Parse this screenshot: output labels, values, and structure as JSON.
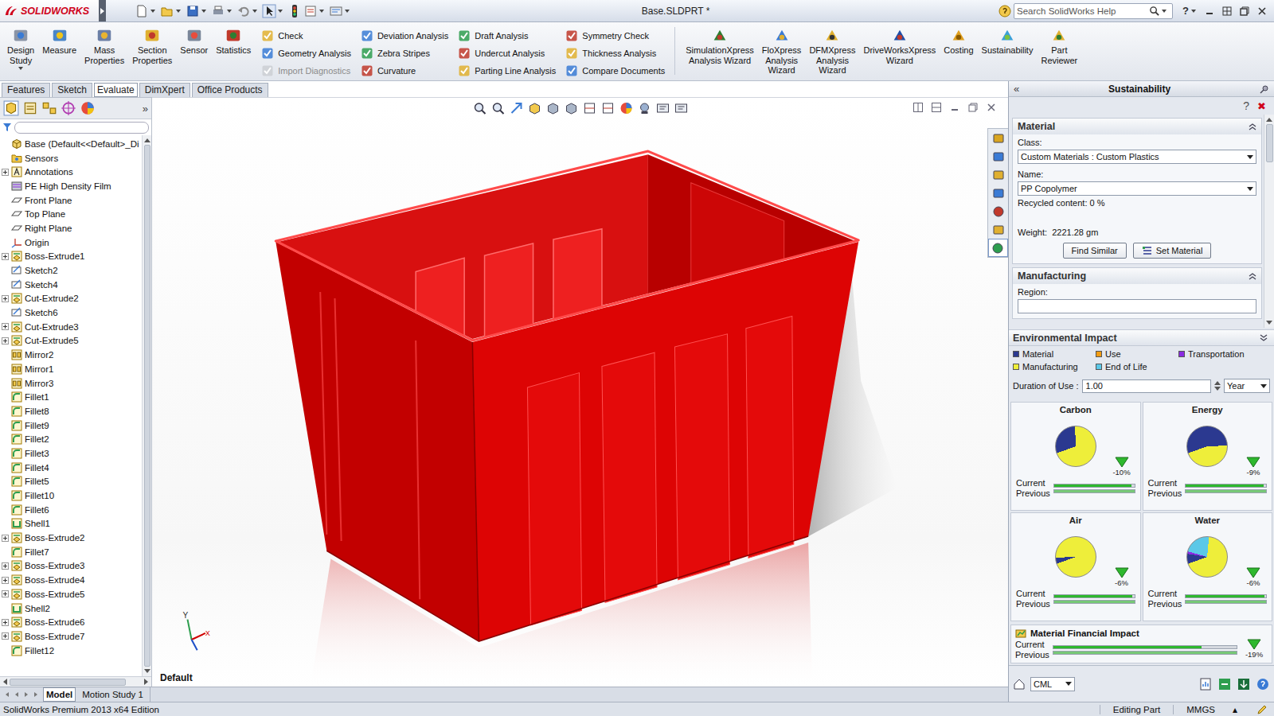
{
  "window": {
    "logo_text": "SOLIDWORKS",
    "title": "Base.SLDPRT *",
    "search_placeholder": "Search SolidWorks Help",
    "help": "?"
  },
  "ribbon": {
    "large_left": [
      {
        "label": "Design\nStudy",
        "dropdown": true
      },
      {
        "label": "Measure",
        "dropdown": false
      },
      {
        "label": "Mass\nProperties",
        "dropdown": false
      },
      {
        "label": "Section\nProperties",
        "dropdown": false
      },
      {
        "label": "Sensor",
        "dropdown": false
      },
      {
        "label": "Statistics",
        "dropdown": false
      }
    ],
    "small_columns": [
      [
        {
          "label": "Check",
          "disabled": false
        },
        {
          "label": "Geometry Analysis",
          "disabled": false
        },
        {
          "label": "Import Diagnostics",
          "disabled": true
        }
      ],
      [
        {
          "label": "Deviation Analysis",
          "disabled": false
        },
        {
          "label": "Zebra Stripes",
          "disabled": false
        },
        {
          "label": "Curvature",
          "disabled": false
        }
      ],
      [
        {
          "label": "Draft Analysis",
          "disabled": false
        },
        {
          "label": "Undercut Analysis",
          "disabled": false
        },
        {
          "label": "Parting Line Analysis",
          "disabled": false
        }
      ],
      [
        {
          "label": "Symmetry Check",
          "disabled": false
        },
        {
          "label": "Thickness Analysis",
          "disabled": false
        },
        {
          "label": "Compare Documents",
          "disabled": false
        }
      ]
    ],
    "large_right": [
      {
        "label": "SimulationXpress\nAnalysis Wizard"
      },
      {
        "label": "FloXpress\nAnalysis\nWizard"
      },
      {
        "label": "DFMXpress\nAnalysis\nWizard"
      },
      {
        "label": "DriveWorksXpress\nWizard"
      },
      {
        "label": "Costing"
      },
      {
        "label": "Sustainability"
      },
      {
        "label": "Part\nReviewer"
      }
    ]
  },
  "tabs": [
    {
      "label": "Features",
      "selected": false
    },
    {
      "label": "Sketch",
      "selected": false
    },
    {
      "label": "Evaluate",
      "selected": true
    },
    {
      "label": "DimXpert",
      "selected": false
    },
    {
      "label": "Office Products",
      "selected": false
    }
  ],
  "tree": {
    "more": "»",
    "items": [
      {
        "label": "Base (Default<<Default>_Di",
        "kind": "part",
        "expandable": false
      },
      {
        "label": "Sensors",
        "kind": "folder",
        "expandable": false
      },
      {
        "label": "Annotations",
        "kind": "annotations",
        "expandable": true
      },
      {
        "label": "PE High Density Film",
        "kind": "material",
        "expandable": false
      },
      {
        "label": "Front Plane",
        "kind": "plane",
        "expandable": false
      },
      {
        "label": "Top Plane",
        "kind": "plane",
        "expandable": false
      },
      {
        "label": "Right Plane",
        "kind": "plane",
        "expandable": false
      },
      {
        "label": "Origin",
        "kind": "origin",
        "expandable": false
      },
      {
        "label": "Boss-Extrude1",
        "kind": "extrude",
        "expandable": true
      },
      {
        "label": "Sketch2",
        "kind": "sketch",
        "expandable": false
      },
      {
        "label": "Sketch4",
        "kind": "sketch",
        "expandable": false
      },
      {
        "label": "Cut-Extrude2",
        "kind": "extrude",
        "expandable": true
      },
      {
        "label": "Sketch6",
        "kind": "sketch",
        "expandable": false
      },
      {
        "label": "Cut-Extrude3",
        "kind": "extrude",
        "expandable": true
      },
      {
        "label": "Cut-Extrude5",
        "kind": "extrude",
        "expandable": true
      },
      {
        "label": "Mirror2",
        "kind": "mirror",
        "expandable": false
      },
      {
        "label": "Mirror1",
        "kind": "mirror",
        "expandable": false
      },
      {
        "label": "Mirror3",
        "kind": "mirror",
        "expandable": false
      },
      {
        "label": "Fillet1",
        "kind": "fillet",
        "expandable": false
      },
      {
        "label": "Fillet8",
        "kind": "fillet",
        "expandable": false
      },
      {
        "label": "Fillet9",
        "kind": "fillet",
        "expandable": false
      },
      {
        "label": "Fillet2",
        "kind": "fillet",
        "expandable": false
      },
      {
        "label": "Fillet3",
        "kind": "fillet",
        "expandable": false
      },
      {
        "label": "Fillet4",
        "kind": "fillet",
        "expandable": false
      },
      {
        "label": "Fillet5",
        "kind": "fillet",
        "expandable": false
      },
      {
        "label": "Fillet10",
        "kind": "fillet",
        "expandable": false
      },
      {
        "label": "Fillet6",
        "kind": "fillet",
        "expandable": false
      },
      {
        "label": "Shell1",
        "kind": "shell",
        "expandable": false
      },
      {
        "label": "Boss-Extrude2",
        "kind": "extrude",
        "expandable": true
      },
      {
        "label": "Fillet7",
        "kind": "fillet",
        "expandable": false
      },
      {
        "label": "Boss-Extrude3",
        "kind": "extrude",
        "expandable": true
      },
      {
        "label": "Boss-Extrude4",
        "kind": "extrude",
        "expandable": true
      },
      {
        "label": "Boss-Extrude5",
        "kind": "extrude",
        "expandable": true
      },
      {
        "label": "Shell2",
        "kind": "shell",
        "expandable": false
      },
      {
        "label": "Boss-Extrude6",
        "kind": "extrude",
        "expandable": true
      },
      {
        "label": "Boss-Extrude7",
        "kind": "extrude",
        "expandable": true
      },
      {
        "label": "Fillet12",
        "kind": "fillet",
        "expandable": false
      }
    ]
  },
  "viewport": {
    "configuration": "Default",
    "triad": {
      "y": "Y",
      "x": "X"
    }
  },
  "task_pane": [
    {
      "selected": false
    },
    {
      "selected": false
    },
    {
      "selected": false
    },
    {
      "selected": false
    },
    {
      "selected": false
    },
    {
      "selected": false
    },
    {
      "selected": true
    }
  ],
  "panel": {
    "collapse": "«",
    "title": "Sustainability",
    "help": "?",
    "close": "✖",
    "material": {
      "title": "Material",
      "class_label": "Class:",
      "class_value": "Custom Materials : Custom Plastics",
      "name_label": "Name:",
      "name_value": "PP Copolymer",
      "recycled": "Recycled content: 0 %",
      "weight": "Weight:  2221.28 gm",
      "buttons": [
        "Find Similar",
        "Set Material"
      ]
    },
    "manufacturing": {
      "title": "Manufacturing",
      "region_label": "Region:"
    },
    "impact": {
      "title": "Environmental Impact",
      "legend": [
        {
          "label": "Material",
          "color": "#2b3990"
        },
        {
          "label": "Use",
          "color": "#f39c12"
        },
        {
          "label": "Transportation",
          "color": "#8b2be2"
        },
        {
          "label": "Manufacturing",
          "color": "#eeee3a"
        },
        {
          "label": "End of Life",
          "color": "#5bc8e8"
        }
      ],
      "duration_label": "Duration of Use :",
      "duration_value": "1.00",
      "duration_unit": "Year",
      "current_label": "Current",
      "previous_label": "Previous",
      "cards": [
        {
          "title": "Carbon",
          "change": "-10%",
          "trend": "down",
          "current": 0.97,
          "previous": 1.0,
          "slices": [
            {
              "share": 0.3,
              "color": "#2b3990"
            },
            {
              "share": 0.7,
              "color": "#eeee3a"
            }
          ]
        },
        {
          "title": "Energy",
          "change": "-9%",
          "trend": "down",
          "current": 0.97,
          "previous": 1.0,
          "slices": [
            {
              "share": 0.55,
              "color": "#2b3990"
            },
            {
              "share": 0.45,
              "color": "#eeee3a"
            }
          ]
        },
        {
          "title": "Air",
          "change": "-6%",
          "trend": "down",
          "current": 0.98,
          "previous": 1.0,
          "slices": [
            {
              "share": 0.05,
              "color": "#2b3990"
            },
            {
              "share": 0.95,
              "color": "#eeee3a"
            }
          ]
        },
        {
          "title": "Water",
          "change": "-6%",
          "trend": "down",
          "current": 0.98,
          "previous": 1.0,
          "slices": [
            {
              "share": 0.08,
              "color": "#2b3990"
            },
            {
              "share": 0.02,
              "color": "#8b2be2"
            },
            {
              "share": 0.22,
              "color": "#5bc8e8"
            },
            {
              "share": 0.68,
              "color": "#eeee3a"
            }
          ]
        }
      ]
    },
    "financial": {
      "title": "Material Financial Impact",
      "change": "-19%",
      "trend": "down",
      "current": 0.81,
      "previous": 1.0
    },
    "footer": {
      "database": "CML"
    }
  },
  "bottom_tabs": [
    {
      "label": "Model",
      "selected": true
    },
    {
      "label": "Motion Study 1",
      "selected": false
    }
  ],
  "status_bar": {
    "edition": "SolidWorks Premium 2013 x64 Edition",
    "mode": "Editing Part",
    "units": "MMGS",
    "units_menu": "▴"
  }
}
